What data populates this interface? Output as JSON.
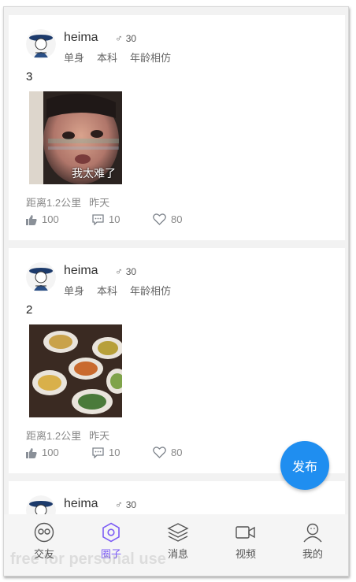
{
  "posts": [
    {
      "username": "heima",
      "gender_symbol": "♂",
      "age": "30",
      "tags": [
        "单身",
        "本科",
        "年龄相仿"
      ],
      "content": "3",
      "image_caption": "我太难了",
      "distance": "距离1.2公里",
      "time": "昨天",
      "likes": "100",
      "comments": "10",
      "favorites": "80"
    },
    {
      "username": "heima",
      "gender_symbol": "♂",
      "age": "30",
      "tags": [
        "单身",
        "本科",
        "年龄相仿"
      ],
      "content": "2",
      "distance": "距离1.2公里",
      "time": "昨天",
      "likes": "100",
      "comments": "10",
      "favorites": "80"
    },
    {
      "username": "heima",
      "gender_symbol": "♂",
      "age": "30"
    }
  ],
  "fab": {
    "label": "发布"
  },
  "tabs": [
    {
      "label": "交友",
      "icon": "friends-icon"
    },
    {
      "label": "圈子",
      "icon": "circle-icon",
      "active": true
    },
    {
      "label": "消息",
      "icon": "layers-icon"
    },
    {
      "label": "视频",
      "icon": "video-icon"
    },
    {
      "label": "我的",
      "icon": "profile-icon"
    }
  ],
  "watermark": "free for personal use",
  "colors": {
    "accent": "#7c5cf5",
    "fab": "#1f8ef0",
    "text_secondary": "#888888"
  }
}
